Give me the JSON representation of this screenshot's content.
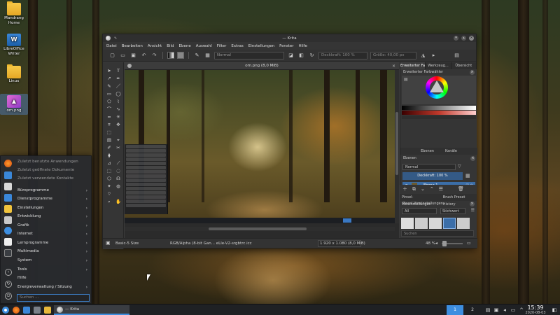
{
  "desktop": {
    "icons": [
      {
        "label": "Mandrang Home",
        "icon": "home-folder-icon"
      },
      {
        "label": "LibreOffice Writer",
        "icon": "writer-icon"
      },
      {
        "label": "Linux",
        "icon": "folder-icon"
      },
      {
        "label": "om.png",
        "icon": "image-file-icon"
      }
    ]
  },
  "krita": {
    "window_title": "— Krita",
    "menu": [
      "Datei",
      "Bearbeiten",
      "Ansicht",
      "Bild",
      "Ebene",
      "Auswahl",
      "Filter",
      "Extras",
      "Einstellungen",
      "Fenster",
      "Hilfe"
    ],
    "toolbar": {
      "blend_mode": "Normal",
      "opacity": "Deckkraft: 100 %",
      "size": "Größe: 40,00 px"
    },
    "document": {
      "title": "om.png (8,0 MiB)"
    },
    "status": {
      "brush": "Basic-5 Size",
      "color_profile": "RGB/Alpha (8-bit Gan... eLle-V2-srgbtrc.icc",
      "dimensions": "1.920 x 1.080 (8,0 MiB)",
      "zoom": "48 %"
    },
    "dock": {
      "top_tabs": [
        "Erweiterter Fa...",
        "Werkzeug...",
        "Übersicht"
      ],
      "color_panel_title": "Erweiterter Farbwähler",
      "mid_tabs": [
        "Ebenen",
        "Kanäle"
      ],
      "layers_title": "Ebenen",
      "layer_blend": "Normal",
      "layer_opacity": "Deckkraft: 100 %",
      "layer_name": "Ebene 1",
      "preset_tabs": [
        "Pinsel-Voreinstellungen",
        "Brush Preset History"
      ],
      "preset_title": "Pinsel-Voreinstellungen",
      "preset_filter": "All",
      "preset_tag": "Stichwort",
      "preset_search": "Suchen"
    }
  },
  "startmenu": {
    "recent": [
      "Zuletzt benutzte Anwendungen",
      "Zuletzt geöffnete Dokumente",
      "Zuletzt verwendete Kontakte"
    ],
    "categories": [
      "Büroprogramme",
      "Dienstprogramme",
      "Einstellungen",
      "Entwicklung",
      "Grafik",
      "Internet",
      "Lernprogramme",
      "Multimedia",
      "System",
      "Tools",
      "Hilfe",
      "Energieverwaltung / Sitzung"
    ],
    "search_placeholder": "Suchen ..."
  },
  "taskbar": {
    "task_label": "— Krita",
    "pager": [
      "1",
      "2"
    ],
    "time": "15:39",
    "date": "2020-08-03"
  },
  "colors": {
    "accent": "#3d8ee0",
    "layer_selected": "#3b6ea8",
    "panel_bg": "#353535"
  }
}
